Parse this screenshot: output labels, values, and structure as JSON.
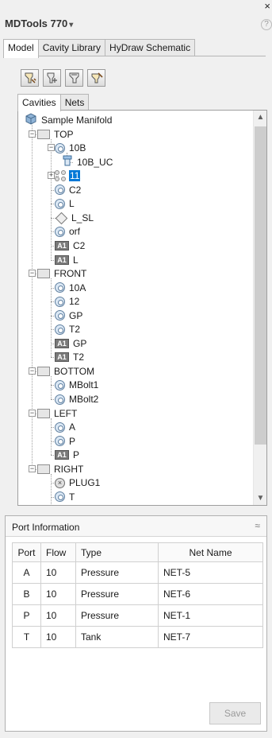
{
  "app": {
    "title": "MDTools 770",
    "caret": "▾",
    "close": "×",
    "help": "?"
  },
  "top_tabs": [
    {
      "label": "Model",
      "active": true
    },
    {
      "label": "Cavity Library",
      "active": false
    },
    {
      "label": "HyDraw Schematic",
      "active": false
    }
  ],
  "toolbar": {
    "buttons": [
      "cavity-add-icon",
      "pattern-add-icon",
      "face-add-icon",
      "cavity-edit-icon"
    ]
  },
  "sub_tabs": [
    {
      "label": "Cavities",
      "active": true
    },
    {
      "label": "Nets",
      "active": false
    }
  ],
  "tree": [
    {
      "label": "Sample Manifold",
      "icon": "manifold-icon",
      "level": 0
    },
    {
      "label": "TOP",
      "icon": "face-icon",
      "level": 1,
      "expander": "−"
    },
    {
      "label": "10B",
      "icon": "cavity-icon",
      "level": 2,
      "expander": "−"
    },
    {
      "label": "10B_UC",
      "icon": "undercut-icon",
      "level": 3
    },
    {
      "label": "11",
      "icon": "pattern-icon",
      "level": 2,
      "expander": "+",
      "selected": true
    },
    {
      "label": "C2",
      "icon": "cavity-icon",
      "level": 2
    },
    {
      "label": "L",
      "icon": "cavity-icon",
      "level": 2
    },
    {
      "label": "L_SL",
      "icon": "diamond-icon",
      "level": 2
    },
    {
      "label": "orf",
      "icon": "cavity-icon",
      "level": 2
    },
    {
      "label": "C2",
      "icon": "a1-icon",
      "level": 2
    },
    {
      "label": "L",
      "icon": "a1-icon",
      "level": 2
    },
    {
      "label": "FRONT",
      "icon": "face-icon",
      "level": 1,
      "expander": "−"
    },
    {
      "label": "10A",
      "icon": "cavity-icon",
      "level": 2
    },
    {
      "label": "12",
      "icon": "cavity-icon",
      "level": 2
    },
    {
      "label": "GP",
      "icon": "cavity-icon",
      "level": 2
    },
    {
      "label": "T2",
      "icon": "cavity-icon",
      "level": 2
    },
    {
      "label": "GP",
      "icon": "a1-icon",
      "level": 2
    },
    {
      "label": "T2",
      "icon": "a1-icon",
      "level": 2
    },
    {
      "label": "BOTTOM",
      "icon": "face-icon",
      "level": 1,
      "expander": "−"
    },
    {
      "label": "MBolt1",
      "icon": "cavity-icon",
      "level": 2
    },
    {
      "label": "MBolt2",
      "icon": "cavity-icon",
      "level": 2
    },
    {
      "label": "LEFT",
      "icon": "face-icon",
      "level": 1,
      "expander": "−"
    },
    {
      "label": "A",
      "icon": "cavity-icon",
      "level": 2
    },
    {
      "label": "P",
      "icon": "cavity-icon",
      "level": 2
    },
    {
      "label": "P",
      "icon": "a1-icon",
      "level": 2
    },
    {
      "label": "RIGHT",
      "icon": "face-icon",
      "level": 1,
      "expander": "−"
    },
    {
      "label": "PLUG1",
      "icon": "plug-icon",
      "level": 2
    },
    {
      "label": "T",
      "icon": "cavity-icon",
      "level": 2
    },
    {
      "label": "T",
      "icon": "a1-icon",
      "level": 2
    }
  ],
  "a1_text": "A1",
  "port_info": {
    "title": "Port Information",
    "collapse": "≈",
    "columns": [
      "Port",
      "Flow",
      "Type",
      "Net Name"
    ],
    "rows": [
      {
        "port": "A",
        "flow": "10",
        "type": "Pressure",
        "net": "NET-5"
      },
      {
        "port": "B",
        "flow": "10",
        "type": "Pressure",
        "net": "NET-6"
      },
      {
        "port": "P",
        "flow": "10",
        "type": "Pressure",
        "net": "NET-1"
      },
      {
        "port": "T",
        "flow": "10",
        "type": "Tank",
        "net": "NET-7"
      }
    ],
    "save_label": "Save"
  },
  "colors": {
    "selection": "#0078d7",
    "panel_bg": "#f0f0f0"
  }
}
